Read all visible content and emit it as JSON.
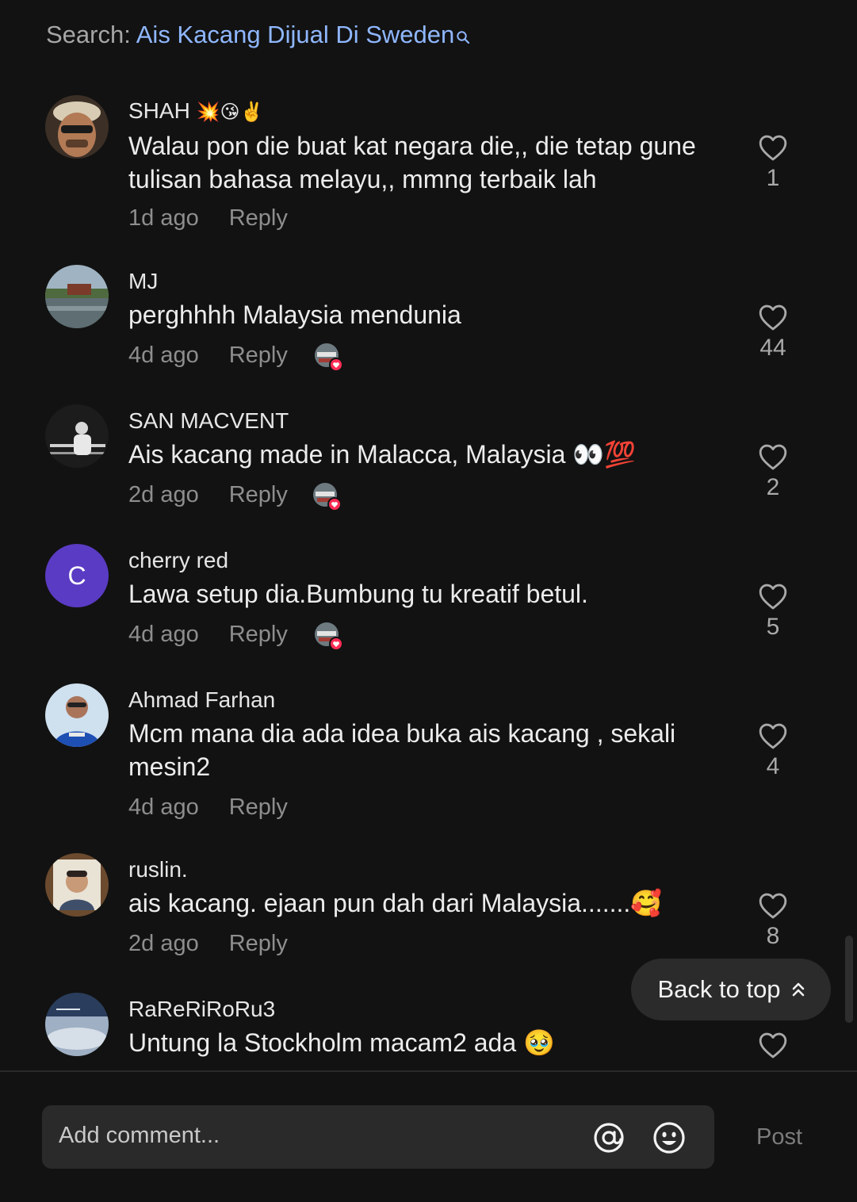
{
  "search": {
    "prefix": "Search: ",
    "term": "Ais Kacang Dijual Di Sweden"
  },
  "comments": [
    {
      "username": "SHAH",
      "username_emoji": "💥😘✌️",
      "text": "Walau pon die buat kat negara die,, die tetap gune tulisan bahasa melayu,, mmng terbaik lah",
      "time": "1d ago",
      "reply": "Reply",
      "likes": "1"
    },
    {
      "username": "MJ",
      "text": "perghhhh Malaysia mendunia",
      "time": "4d ago",
      "reply": "Reply",
      "likes": "44"
    },
    {
      "username": "SAN MACVENT",
      "text": "Ais kacang made in Malacca, Malaysia 👀💯",
      "time": "2d ago",
      "reply": "Reply",
      "likes": "2"
    },
    {
      "username": "cherry red",
      "avatar_letter": "C",
      "text": "Lawa setup dia.Bumbung tu kreatif betul.",
      "time": "4d ago",
      "reply": "Reply",
      "likes": "5"
    },
    {
      "username": "Ahmad Farhan",
      "text": "Mcm mana dia ada idea buka ais kacang , sekali mesin2",
      "time": "4d ago",
      "reply": "Reply",
      "likes": "4"
    },
    {
      "username": "ruslin.",
      "text": "ais kacang. ejaan pun dah dari Malaysia.......🥰",
      "time": "2d ago",
      "reply": "Reply",
      "likes": "8"
    },
    {
      "username": "RaReRiRoRu3",
      "text": "Untung la Stockholm macam2 ada 🥹"
    }
  ],
  "back_to_top": {
    "label": "Back to top"
  },
  "composer": {
    "placeholder": "Add comment...",
    "post_label": "Post"
  },
  "colors": {
    "background": "#121212",
    "search_term": "#8fb7ff",
    "avatar_letter_bg": "#5a3bc3",
    "creator_heart": "#fe2c55"
  },
  "icons": {
    "search": "search-icon",
    "like": "heart-outline-icon",
    "back_to_top": "double-chevron-up-icon",
    "mention": "at-sign-icon",
    "emoji": "smiley-icon"
  }
}
